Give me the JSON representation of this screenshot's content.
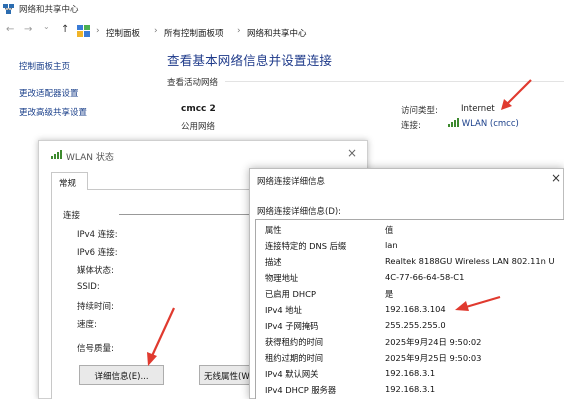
{
  "window": {
    "title": "网络和共享中心"
  },
  "nav": {
    "back_icon": "←",
    "forward_icon": "→",
    "dropdown_icon": "⌄",
    "up_icon": "↑",
    "breadcrumbs": [
      "控制面板",
      "所有控制面板项",
      "网络和共享中心"
    ],
    "separator": "›"
  },
  "sidebar": {
    "items": [
      {
        "label": "控制面板主页"
      },
      {
        "label": "更改适配器设置"
      },
      {
        "label": "更改高级共享设置"
      }
    ]
  },
  "main": {
    "title": "查看基本网络信息并设置连接",
    "section_label": "查看活动网络",
    "network_name": "cmcc  2",
    "network_type": "公用网络",
    "access_type_label": "访问类型:",
    "access_type_value": "Internet",
    "connection_label": "连接:",
    "connection_value": "WLAN (cmcc)"
  },
  "wlan_dialog": {
    "title": "WLAN 状态",
    "close": "×",
    "tab": "常规",
    "group_label": "连接",
    "rows": [
      "IPv4 连接:",
      "IPv6 连接:",
      "媒体状态:",
      "SSID:",
      "持续时间:",
      "速度:"
    ],
    "signal_label": "信号质量:",
    "details_button": "详细信息(E)...",
    "wireless_button": "无线属性(W)"
  },
  "details_dialog": {
    "title": "网络连接详细信息",
    "close": "×",
    "list_label": "网络连接详细信息(D):",
    "columns": {
      "property": "属性",
      "value": "值"
    },
    "rows": [
      {
        "property": "连接特定的 DNS 后缀",
        "value": "lan"
      },
      {
        "property": "描述",
        "value": "Realtek 8188GU Wireless LAN 802.11n U"
      },
      {
        "property": "物理地址",
        "value": "4C-77-66-64-58-C1"
      },
      {
        "property": "已启用 DHCP",
        "value": "是"
      },
      {
        "property": "IPv4 地址",
        "value": "192.168.3.104"
      },
      {
        "property": "IPv4 子网掩码",
        "value": "255.255.255.0"
      },
      {
        "property": "获得租约的时间",
        "value": "2025年9月24日 9:50:02"
      },
      {
        "property": "租约过期的时间",
        "value": "2025年9月25日 9:50:03"
      },
      {
        "property": "IPv4 默认网关",
        "value": "192.168.3.1"
      },
      {
        "property": "IPv4 DHCP 服务器",
        "value": "192.168.3.1"
      }
    ]
  },
  "colors": {
    "link": "#1a3f8a",
    "title": "#1e3a8a",
    "annotation": "#e03a2f",
    "signal": "#3d8a2e"
  }
}
